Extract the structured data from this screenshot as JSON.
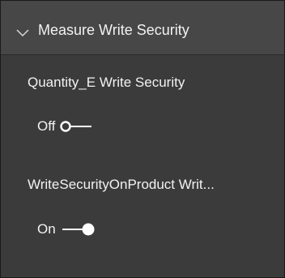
{
  "section": {
    "title": "Measure Write Security",
    "expanded": true,
    "chevron_icon": "chevron-down-icon"
  },
  "properties": [
    {
      "label": "Quantity_E Write Security",
      "toggle_state": "Off",
      "value": false
    },
    {
      "label": "WriteSecurityOnProduct Writ...",
      "toggle_state": "On",
      "value": true
    }
  ],
  "colors": {
    "panel_bg": "#3b3b3b",
    "header_bg": "#474747",
    "text": "#f2f2f2",
    "toggle": "#ffffff"
  }
}
